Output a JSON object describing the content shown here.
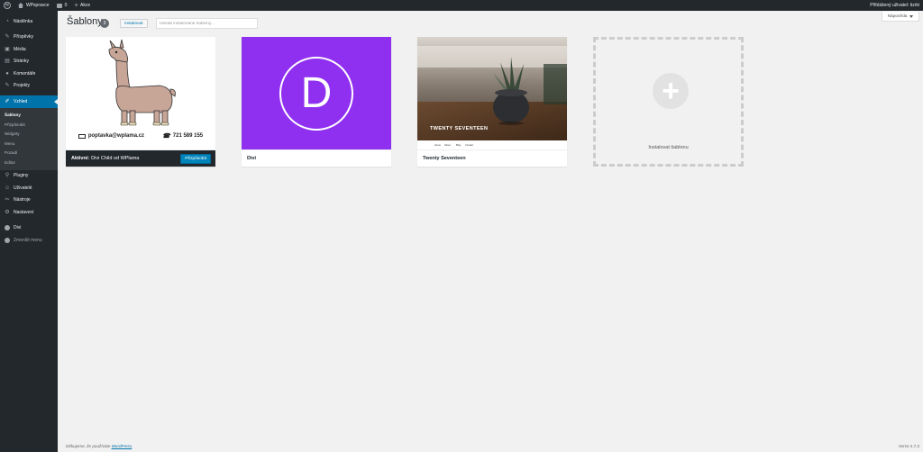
{
  "adminbar": {
    "site_name": "WPspravce",
    "comments_count": "0",
    "new_label": "Akce",
    "greeting": "Přihlášený uživatel: tizrki"
  },
  "sidebar": {
    "items": [
      {
        "label": "Nástěnka",
        "icon": "dashboard-icon"
      },
      {
        "label": "Příspěvky",
        "icon": "pin-icon"
      },
      {
        "label": "Média",
        "icon": "media-icon"
      },
      {
        "label": "Stránky",
        "icon": "pages-icon"
      },
      {
        "label": "Komentáře",
        "icon": "comments-icon"
      },
      {
        "label": "Projekty",
        "icon": "pin-icon"
      },
      {
        "label": "Vzhled",
        "icon": "brush-icon"
      },
      {
        "label": "Pluginy",
        "icon": "plugin-icon"
      },
      {
        "label": "Uživatelé",
        "icon": "users-icon"
      },
      {
        "label": "Nástroje",
        "icon": "tools-icon"
      },
      {
        "label": "Nastavení",
        "icon": "settings-icon"
      },
      {
        "label": "Divi",
        "icon": "divi-icon"
      },
      {
        "label": "Zmenšit menu",
        "icon": "collapse-icon"
      }
    ],
    "submenu": [
      "Šablony",
      "Přizpůsobit",
      "Widgety",
      "Menu",
      "Pozadí",
      "Editor"
    ]
  },
  "header": {
    "title": "Šablony",
    "count": "3",
    "add_new": "Instalovat",
    "search_placeholder": "Hledat instalované šablony...",
    "help": "Nápověda"
  },
  "themes": {
    "active": {
      "active_prefix": "Aktivní:",
      "name": "Divi Child od WPlama",
      "customize": "Přizpůsobit",
      "email": "poptavka@wplama.cz",
      "phone": "721 589 155"
    },
    "divi": {
      "name": "Divi",
      "logo_letter": "D"
    },
    "twenty": {
      "name": "Twenty Seventeen",
      "hero_title": "TWENTY SEVENTEEN",
      "nav": [
        "Home",
        "About",
        "Blog",
        "Contact"
      ]
    },
    "add_label": "Instalovat šablonu"
  },
  "footer": {
    "thanks_prefix": "Děkujeme, že používáte ",
    "wordpress_link": "WordPress",
    "thanks_suffix": ".",
    "version": "Verze 4.7.3"
  },
  "colors": {
    "admin_bg": "#23282d",
    "accent": "#0073aa",
    "divi_purple": "#8f2ff0"
  }
}
